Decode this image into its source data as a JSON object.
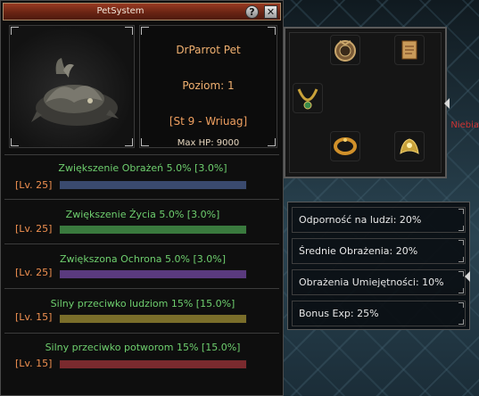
{
  "window": {
    "title": "PetSystem",
    "help_label": "?",
    "close_label": "✕"
  },
  "pet": {
    "name": "DrParrot Pet",
    "level": "Poziom: 1",
    "stage": "[St 9 - Wriuag]",
    "max_hp": "Max HP: 9000"
  },
  "bonuses": [
    {
      "label": "Zwiększenie Obrażeń  5.0% [3.0%]",
      "level": "[Lv. 25]",
      "color": "#3a4a6e"
    },
    {
      "label": "Zwiększenie Życia  5.0% [3.0%]",
      "level": "[Lv. 25]",
      "color": "#3a7a3e"
    },
    {
      "label": "Zwiększona Ochrona  5.0% [3.0%]",
      "level": "[Lv. 25]",
      "color": "#5a3a7e"
    },
    {
      "label": "Silny przeciwko ludziom  15% [15.0%]",
      "level": "[Lv. 15]",
      "color": "#7a6e2a"
    },
    {
      "label": "Silny przeciwko potworom  15% [15.0%]",
      "level": "[Lv. 15]",
      "color": "#7a2a2e"
    }
  ],
  "items": [
    {
      "icon": "compass-pendant-icon"
    },
    {
      "icon": "scroll-icon"
    },
    {
      "icon": "necklace-icon"
    },
    {
      "icon": "bracelet-icon"
    },
    {
      "icon": "wing-emblem-icon"
    }
  ],
  "stats": [
    "Odporność na ludzi: 20%",
    "Średnie Obrażenia: 20%",
    "Obrażenia Umiejętności: 10%",
    "Bonus Exp: 25%"
  ],
  "world": {
    "npc_label": "Niebia"
  }
}
